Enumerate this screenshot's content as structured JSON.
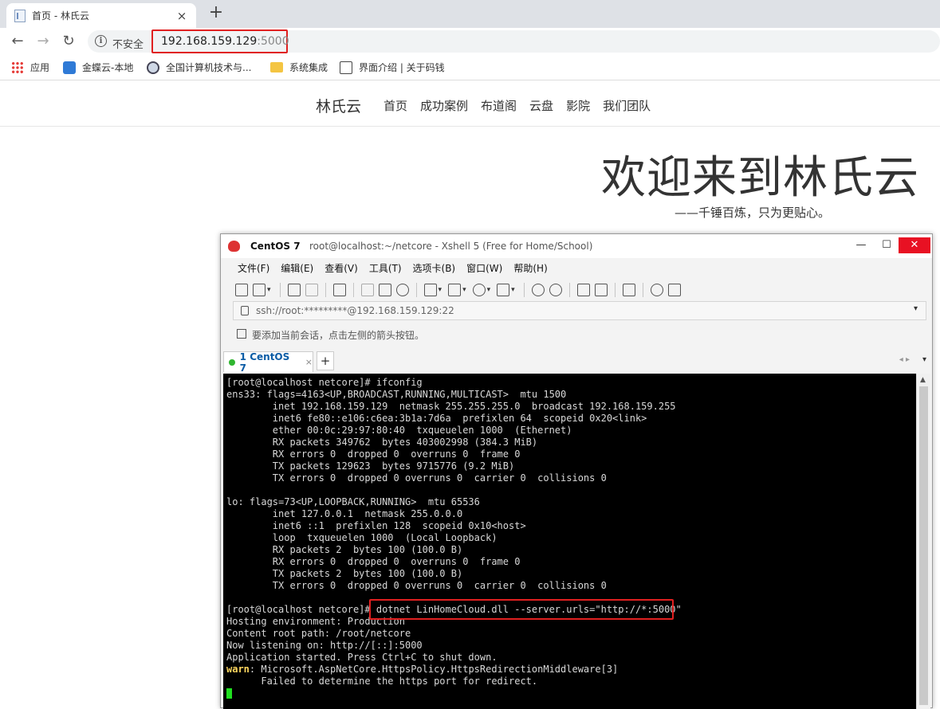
{
  "browser": {
    "tab_title": "首页 - 林氏云",
    "tab_close": "×",
    "new_tab": "+",
    "nav": {
      "back": "←",
      "forward": "→",
      "reload": "↻"
    },
    "security_label": "不安全",
    "url_host": "192.168.159.129",
    "url_port": ":5000",
    "bookmarks": [
      {
        "label": "应用",
        "icon": "apps-grid-icon"
      },
      {
        "label": "金蝶云-本地",
        "icon": "kingdee-icon"
      },
      {
        "label": "全国计算机技术与...",
        "icon": "globe-icon"
      },
      {
        "label": "系统集成",
        "icon": "folder-icon"
      },
      {
        "label": "界面介绍 | 关于码钱",
        "icon": "book-icon"
      }
    ]
  },
  "site": {
    "brand": "林氏云",
    "nav_links": [
      "首页",
      "成功案例",
      "布道阁",
      "云盘",
      "影院",
      "我们团队"
    ],
    "hero_title": "欢迎来到林氏云",
    "hero_subtitle": "——千锤百炼，只为更贴心。"
  },
  "xshell": {
    "app_name": "CentOS 7",
    "window_title": "root@localhost:~/netcore - Xshell 5 (Free for Home/School)",
    "win_buttons": {
      "minimize": "—",
      "maximize": "☐",
      "close": "✕"
    },
    "menu": [
      "文件(F)",
      "编辑(E)",
      "查看(V)",
      "工具(T)",
      "选项卡(B)",
      "窗口(W)",
      "帮助(H)"
    ],
    "address": "ssh://root:*********@192.168.159.129:22",
    "hint": "要添加当前会话，点击左侧的箭头按钮。",
    "tab_label": "1 CentOS 7",
    "tab_close": "×",
    "tab_add": "+",
    "terminal_lines": [
      "[root@localhost netcore]# ifconfig",
      "ens33: flags=4163<UP,BROADCAST,RUNNING,MULTICAST>  mtu 1500",
      "        inet 192.168.159.129  netmask 255.255.255.0  broadcast 192.168.159.255",
      "        inet6 fe80::e106:c6ea:3b1a:7d6a  prefixlen 64  scopeid 0x20<link>",
      "        ether 00:0c:29:97:80:40  txqueuelen 1000  (Ethernet)",
      "        RX packets 349762  bytes 403002998 (384.3 MiB)",
      "        RX errors 0  dropped 0  overruns 0  frame 0",
      "        TX packets 129623  bytes 9715776 (9.2 MiB)",
      "        TX errors 0  dropped 0 overruns 0  carrier 0  collisions 0",
      "",
      "lo: flags=73<UP,LOOPBACK,RUNNING>  mtu 65536",
      "        inet 127.0.0.1  netmask 255.0.0.0",
      "        inet6 ::1  prefixlen 128  scopeid 0x10<host>",
      "        loop  txqueuelen 1000  (Local Loopback)",
      "        RX packets 2  bytes 100 (100.0 B)",
      "        RX errors 0  dropped 0  overruns 0  frame 0",
      "        TX packets 2  bytes 100 (100.0 B)",
      "        TX errors 0  dropped 0 overruns 0  carrier 0  collisions 0",
      "",
      "[root@localhost netcore]# dotnet LinHomeCloud.dll --server.urls=\"http://*:5000\"",
      "Hosting environment: Production",
      "Content root path: /root/netcore",
      "Now listening on: http://[::]:5000",
      "Application started. Press Ctrl+C to shut down."
    ],
    "warn_label": "warn",
    "warn_rest": ": Microsoft.AspNetCore.HttpsPolicy.HttpsRedirectionMiddleware[3]",
    "warn_detail": "      Failed to determine the https port for redirect."
  },
  "colors": {
    "highlight_red": "#e02020",
    "cursor_green": "#20e020"
  }
}
